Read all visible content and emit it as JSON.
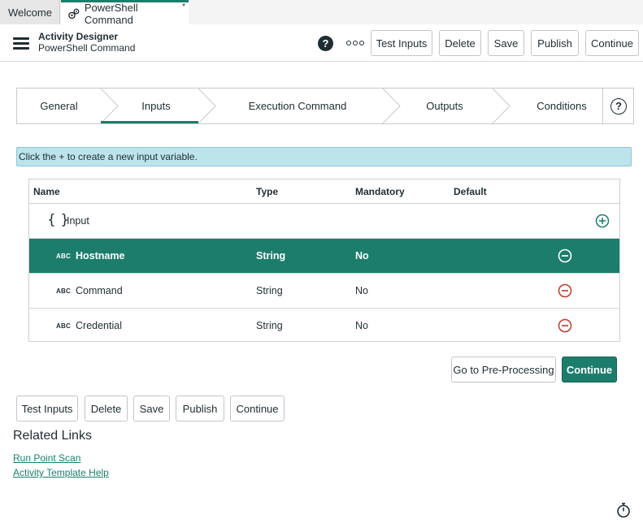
{
  "tabs": [
    {
      "label": "Welcome"
    },
    {
      "label": "PowerShell Command",
      "modified_marker": "*"
    }
  ],
  "header": {
    "title": "Activity Designer",
    "subtitle": "PowerShell Command",
    "help_glyph": "?",
    "actions": {
      "test_inputs": "Test Inputs",
      "delete": "Delete",
      "save": "Save",
      "publish": "Publish",
      "continue": "Continue"
    }
  },
  "stepper": {
    "steps": [
      "General",
      "Inputs",
      "Execution Command",
      "Outputs",
      "Conditions"
    ],
    "active_step": "Inputs",
    "help_glyph": "?"
  },
  "info_message": "Click the + to create a new input variable.",
  "inputs_table": {
    "columns": [
      "Name",
      "Type",
      "Mandatory",
      "Default"
    ],
    "group": {
      "braces": "{ }",
      "label": "Input"
    },
    "type_badge": "ABC",
    "rows": [
      {
        "name": "Hostname",
        "type": "String",
        "mandatory": "No",
        "default": "",
        "selected": true
      },
      {
        "name": "Command",
        "type": "String",
        "mandatory": "No",
        "default": "",
        "selected": false
      },
      {
        "name": "Credential",
        "type": "String",
        "mandatory": "No",
        "default": "",
        "selected": false
      }
    ]
  },
  "form_actions": {
    "go_preprocessing": "Go to Pre-Processing",
    "continue": "Continue"
  },
  "bottom_actions": {
    "test_inputs": "Test Inputs",
    "delete": "Delete",
    "save": "Save",
    "publish": "Publish",
    "continue": "Continue"
  },
  "related_links": {
    "title": "Related Links",
    "items": [
      "Run Point Scan",
      "Activity Template Help"
    ]
  },
  "colors": {
    "accent": "#1d7d6c",
    "info_bg": "#bde3eb",
    "remove_red": "#c0392b"
  }
}
